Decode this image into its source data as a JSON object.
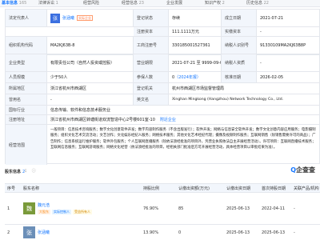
{
  "tabs": [
    {
      "label": "基本信息",
      "count": "165"
    },
    {
      "label": "法律诉讼",
      "count": "1"
    },
    {
      "label": "经营风险",
      "count": ""
    },
    {
      "label": "经营信息",
      "count": "23"
    },
    {
      "label": "企业发展",
      "count": ""
    },
    {
      "label": "知识产权",
      "count": "2"
    },
    {
      "label": "历史信息",
      "count": "22"
    }
  ],
  "info": {
    "legal_rep_label": "法定代表人",
    "legal_rep_avatar": "张",
    "legal_rep_name": "张涵曦",
    "legal_rep_tag": "实际企业",
    "reg_status_label": "登记状态",
    "reg_status": "存续",
    "est_date_label": "成立日期",
    "est_date": "2021-07-21",
    "reg_capital_label": "注册资本",
    "reg_capital": "111.1111万元",
    "paid_capital_label": "实缴资本",
    "paid_capital": "-",
    "org_code_label": "组织机构代码",
    "org_code": "MA2KJ63B-8",
    "reg_no_label": "工商注册号",
    "reg_no": "330185001527361",
    "taxpayer_id_label": "纳税人识别号",
    "taxpayer_id": "91330109MA2KJ63B8P",
    "credit_code_label": "统一社会信用代码",
    "credit_code": "91330109MA2KJ63B8P",
    "company_type_label": "企业类型",
    "company_type": "有限责任公司（自然人投资或控股）",
    "biz_term_label": "营业期限",
    "biz_term": "2021-07-21 至 9999-09-09",
    "taxpayer_quality_label": "纳税人资质",
    "taxpayer_quality": "-",
    "staff_label": "人员规模",
    "staff": "少于50人",
    "insured_label": "参保人数",
    "insured": "0",
    "insured_note": "（2024年报）",
    "approval_date_label": "核准日期",
    "approval_date": "2026-02-05",
    "region_label": "所属地区",
    "region": "浙江省杭州市西湖区",
    "authority_label": "登记机关",
    "authority": "杭州市西湖区市场监督管理局",
    "former_name_label": "曾用名",
    "former_name": "-",
    "english_name_label": "英文名",
    "english_name": "Xinghan Mingkong (Hangzhou) Network Technology Co., Ltd.",
    "industry_label": "国标行业",
    "industry": "信息传输、软件和信息技术服务业",
    "reg_addr_label": "注册地址",
    "reg_addr": "浙江省杭州市西湖区转塘街道双流智造中心2号楼601室-10",
    "nearby_label": "附近企业",
    "scope_label": "经营范围",
    "scope": "一般项目：信息技术咨询服务；数字文化创意软件开发；数字内容制作服务（不含出版发行）；软件开发；网络与信息安全软件开发；数字文化创意内容应用服务；电影摄制服务；组织文化艺术交流活动；文艺创作；文化娱乐经纪人服务；网络技术服务；其他文化艺术经纪代理；摄像及视频制作服务；互联网销售（除销售需要许可的商品）；广告制作；信息系统运行维护服务；软件外包服务；个人互联网直播服务（除依法须经批准的项目外，凭营业执照依法自主开展经营活动）。许可项目：互联网直播技术服务；互联网信息服务；互联网游戏服务；网络文化经营（依法须经批准的项目，经相关部门批准后方可开展经营活动，具体经营项目以审批结果为准）。"
  },
  "shareholders": {
    "title": "股东信息",
    "count": "2",
    "brand": "企查查",
    "brand_suffix": "",
    "headers": [
      "序号",
      "股东名称",
      "持股比例",
      "认缴出资额(万元)",
      "认缴出资日期",
      "首次持股日期",
      "关联产品/机构"
    ],
    "rows": [
      {
        "no": "1",
        "avatar": "魏",
        "name": "魏元浩",
        "badges": [
          "大股东",
          "实际控制人",
          "受益所有人"
        ],
        "ratio": "76.90%",
        "amount": "85",
        "sub_date": "2025-06-13",
        "first_date": "2022-04-11",
        "related": "-"
      },
      {
        "no": "2",
        "avatar": "张",
        "name": "张涵曦",
        "badges": [],
        "ratio": "13.90%",
        "amount": "0",
        "sub_date": "2025-06-13",
        "first_date": "2025-06-13",
        "related": "-"
      }
    ]
  }
}
